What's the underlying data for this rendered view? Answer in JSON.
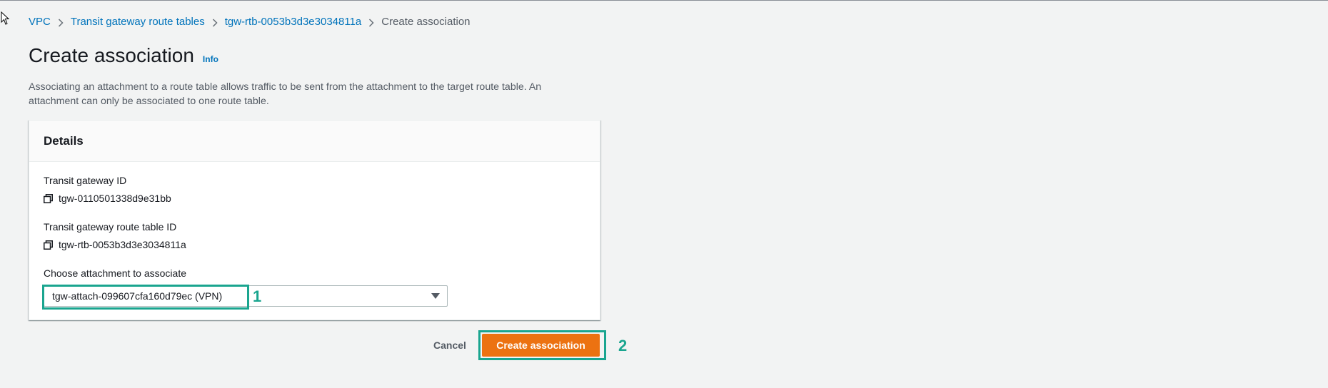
{
  "breadcrumb": {
    "items": [
      {
        "label": "VPC"
      },
      {
        "label": "Transit gateway route tables"
      },
      {
        "label": "tgw-rtb-0053b3d3e3034811a"
      },
      {
        "label": "Create association"
      }
    ]
  },
  "header": {
    "title": "Create association",
    "info_label": "Info",
    "description": "Associating an attachment to a route table allows traffic to be sent from the attachment to the target route table. An attachment can only be associated to one route table."
  },
  "details": {
    "title": "Details",
    "transit_gateway_id_label": "Transit gateway ID",
    "transit_gateway_id_value": "tgw-0110501338d9e31bb",
    "route_table_id_label": "Transit gateway route table ID",
    "route_table_id_value": "tgw-rtb-0053b3d3e3034811a",
    "attachment_label": "Choose attachment to associate",
    "attachment_selected": "tgw-attach-099607cfa160d79ec (VPN)"
  },
  "annotations": {
    "step1": "1",
    "step2": "2",
    "highlight_color": "#1aa58f"
  },
  "actions": {
    "cancel_label": "Cancel",
    "create_label": "Create association"
  },
  "colors": {
    "primary_button": "#ec7211",
    "link": "#0073bb",
    "background": "#f2f3f3"
  },
  "icons": {
    "copy": "copy-icon",
    "breadcrumb_separator": "chevron-right-icon",
    "select_caret": "caret-down-icon",
    "cursor": "mouse-pointer-icon"
  }
}
